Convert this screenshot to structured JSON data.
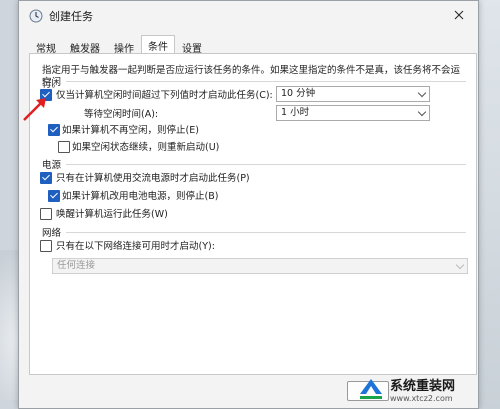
{
  "window": {
    "title": "创建任务"
  },
  "tabs": [
    {
      "label": "常规"
    },
    {
      "label": "触发器"
    },
    {
      "label": "操作"
    },
    {
      "label": "条件"
    },
    {
      "label": "设置"
    }
  ],
  "description": "指定用于与触发器一起判断是否应运行该任务的条件。如果这里指定的条件不是真，该任务将不会运行。",
  "idle": {
    "section": "空闲",
    "start_if_idle": {
      "label": "仅当计算机空闲时间超过下列值时才启动此任务(C):",
      "checked": true,
      "value": "10 分钟"
    },
    "wait_for_idle": {
      "label": "等待空闲时间(A):",
      "value": "1 小时"
    },
    "stop_if_not_idle": {
      "label": "如果计算机不再空闲，则停止(E)",
      "checked": true
    },
    "restart_if_idle": {
      "label": "如果空闲状态继续，则重新启动(U)",
      "checked": false
    }
  },
  "power": {
    "section": "电源",
    "ac_only": {
      "label": "只有在计算机使用交流电源时才启动此任务(P)",
      "checked": true
    },
    "stop_on_battery": {
      "label": "如果计算机改用电池电源，则停止(B)",
      "checked": true
    },
    "wake": {
      "label": "唤醒计算机运行此任务(W)",
      "checked": false
    }
  },
  "network": {
    "section": "网络",
    "only_if_connection": {
      "label": "只有在以下网络连接可用时才启动(Y):",
      "checked": false
    },
    "connection_value": "任何连接"
  },
  "watermark": {
    "text": "系统重装网",
    "url": "www.xtcz2.com"
  }
}
